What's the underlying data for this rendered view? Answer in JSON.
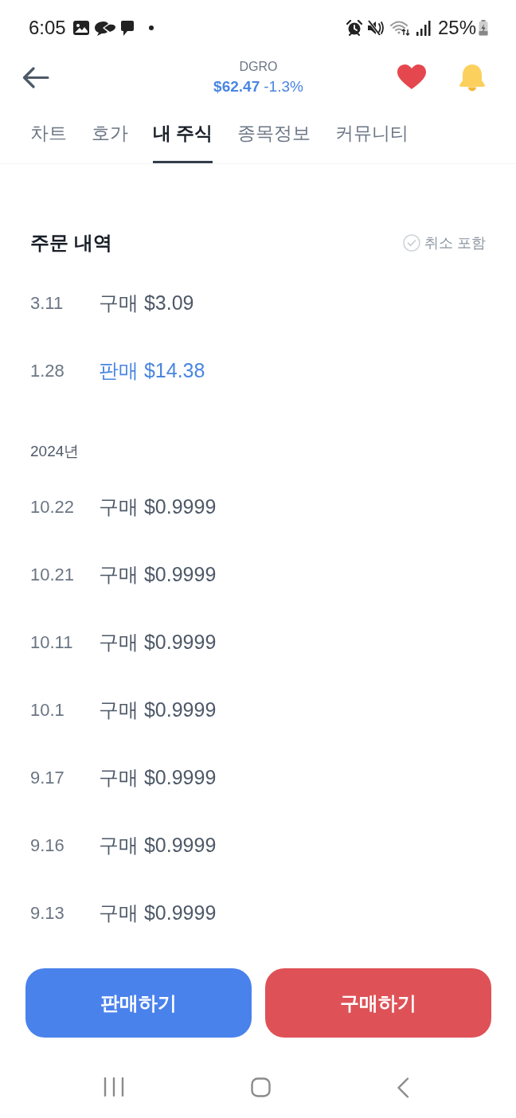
{
  "status_bar": {
    "time": "6:05",
    "battery": "25%"
  },
  "header": {
    "ticker": "DGRO",
    "price": "$62.47",
    "change": "-1.3%",
    "favorite": true
  },
  "tabs": [
    {
      "label": "차트",
      "selected": false
    },
    {
      "label": "호가",
      "selected": false
    },
    {
      "label": "내 주식",
      "selected": true
    },
    {
      "label": "종목정보",
      "selected": false
    },
    {
      "label": "커뮤니티",
      "selected": false
    }
  ],
  "order_history": {
    "title": "주문 내역",
    "include_cancelled": {
      "label": "취소 포함",
      "checked": false
    },
    "groups": [
      {
        "orders": [
          {
            "date": "3.11",
            "kind": "buy",
            "text": "구매 $3.09"
          },
          {
            "date": "1.28",
            "kind": "sell",
            "text": "판매 $14.38"
          }
        ]
      },
      {
        "year": "2024년",
        "orders": [
          {
            "date": "10.22",
            "kind": "buy",
            "text": "구매 $0.9999"
          },
          {
            "date": "10.21",
            "kind": "buy",
            "text": "구매 $0.9999"
          },
          {
            "date": "10.11",
            "kind": "buy",
            "text": "구매 $0.9999"
          },
          {
            "date": "10.1",
            "kind": "buy",
            "text": "구매 $0.9999"
          },
          {
            "date": "9.17",
            "kind": "buy",
            "text": "구매 $0.9999"
          },
          {
            "date": "9.16",
            "kind": "buy",
            "text": "구매 $0.9999"
          },
          {
            "date": "9.13",
            "kind": "buy",
            "text": "구매 $0.9999"
          }
        ]
      }
    ]
  },
  "actions": [
    {
      "kind": "sell",
      "label": "판매하기"
    },
    {
      "kind": "buy",
      "label": "구매하기"
    }
  ]
}
